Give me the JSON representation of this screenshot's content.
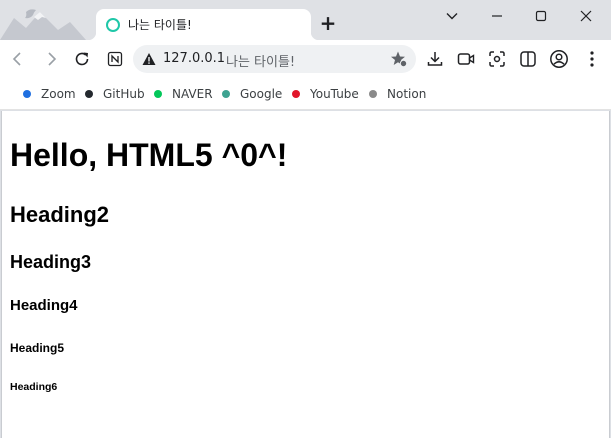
{
  "tab": {
    "title": "나는 타이틀!"
  },
  "new_tab_label": "+",
  "address": {
    "host": "127.0.0.1",
    "page_title": "나는 타이틀!"
  },
  "bookmarks": [
    {
      "label": "Zoom",
      "color": "#1f6fe0"
    },
    {
      "label": "GitHub",
      "color": "#24292f"
    },
    {
      "label": "NAVER",
      "color": "#03c75a"
    },
    {
      "label": "Google",
      "color": "#3ea391"
    },
    {
      "label": "YouTube",
      "color": "#e1162a"
    },
    {
      "label": "Notion",
      "color": "#8a8a8a"
    }
  ],
  "page": {
    "h1": "Hello, HTML5 ^0^!",
    "h2": "Heading2",
    "h3": "Heading3",
    "h4": "Heading4",
    "h5": "Heading5",
    "h6": "Heading6"
  }
}
